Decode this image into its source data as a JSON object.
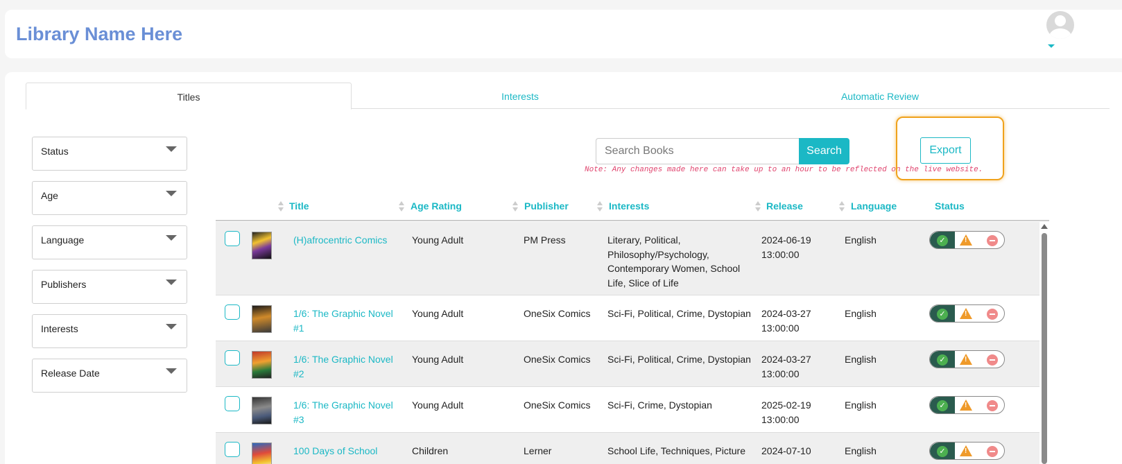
{
  "header": {
    "library_name": "Library Name Here"
  },
  "tabs": [
    {
      "label": "Titles",
      "active": true
    },
    {
      "label": "Interests",
      "active": false
    },
    {
      "label": "Automatic Review",
      "active": false
    }
  ],
  "filters": [
    "Status",
    "Age",
    "Language",
    "Publishers",
    "Interests",
    "Release Date"
  ],
  "search": {
    "placeholder": "Search Books",
    "button_label": "Search"
  },
  "export_label": "Export",
  "note": "Note: Any changes made here can take up to an hour to be reflected on the live website.",
  "table": {
    "columns": [
      "Title",
      "Age Rating",
      "Publisher",
      "Interests",
      "Release",
      "Language",
      "Status"
    ],
    "rows": [
      {
        "title": "(H)afrocentric Comics",
        "age_rating": "Young Adult",
        "publisher": "PM Press",
        "interests": "Literary, Political, Philosophy/Psychology, Contemporary Women, School Life, Slice of Life",
        "release": "2024-06-19 13:00:00",
        "language": "English"
      },
      {
        "title": "1/6: The Graphic Novel #1",
        "age_rating": "Young Adult",
        "publisher": "OneSix Comics",
        "interests": "Sci-Fi, Political, Crime, Dystopian",
        "release": "2024-03-27 13:00:00",
        "language": "English"
      },
      {
        "title": "1/6: The Graphic Novel #2",
        "age_rating": "Young Adult",
        "publisher": "OneSix Comics",
        "interests": "Sci-Fi, Political, Crime, Dystopian",
        "release": "2024-03-27 13:00:00",
        "language": "English"
      },
      {
        "title": "1/6: The Graphic Novel #3",
        "age_rating": "Young Adult",
        "publisher": "OneSix Comics",
        "interests": "Sci-Fi, Crime, Dystopian",
        "release": "2025-02-19 13:00:00",
        "language": "English"
      },
      {
        "title": "100 Days of School",
        "age_rating": "Children",
        "publisher": "Lerner",
        "interests": "School Life, Techniques, Picture",
        "release": "2024-07-10",
        "language": "English"
      }
    ]
  },
  "colors": {
    "accent": "#1bb8c5",
    "brand_title": "#6a8fd6",
    "highlight": "#f0a21c",
    "note": "#e0446e"
  },
  "icons": {
    "avatar": "user-avatar-icon",
    "approve": "check-icon",
    "flag": "warning-icon",
    "reject": "minus-circle-icon"
  }
}
